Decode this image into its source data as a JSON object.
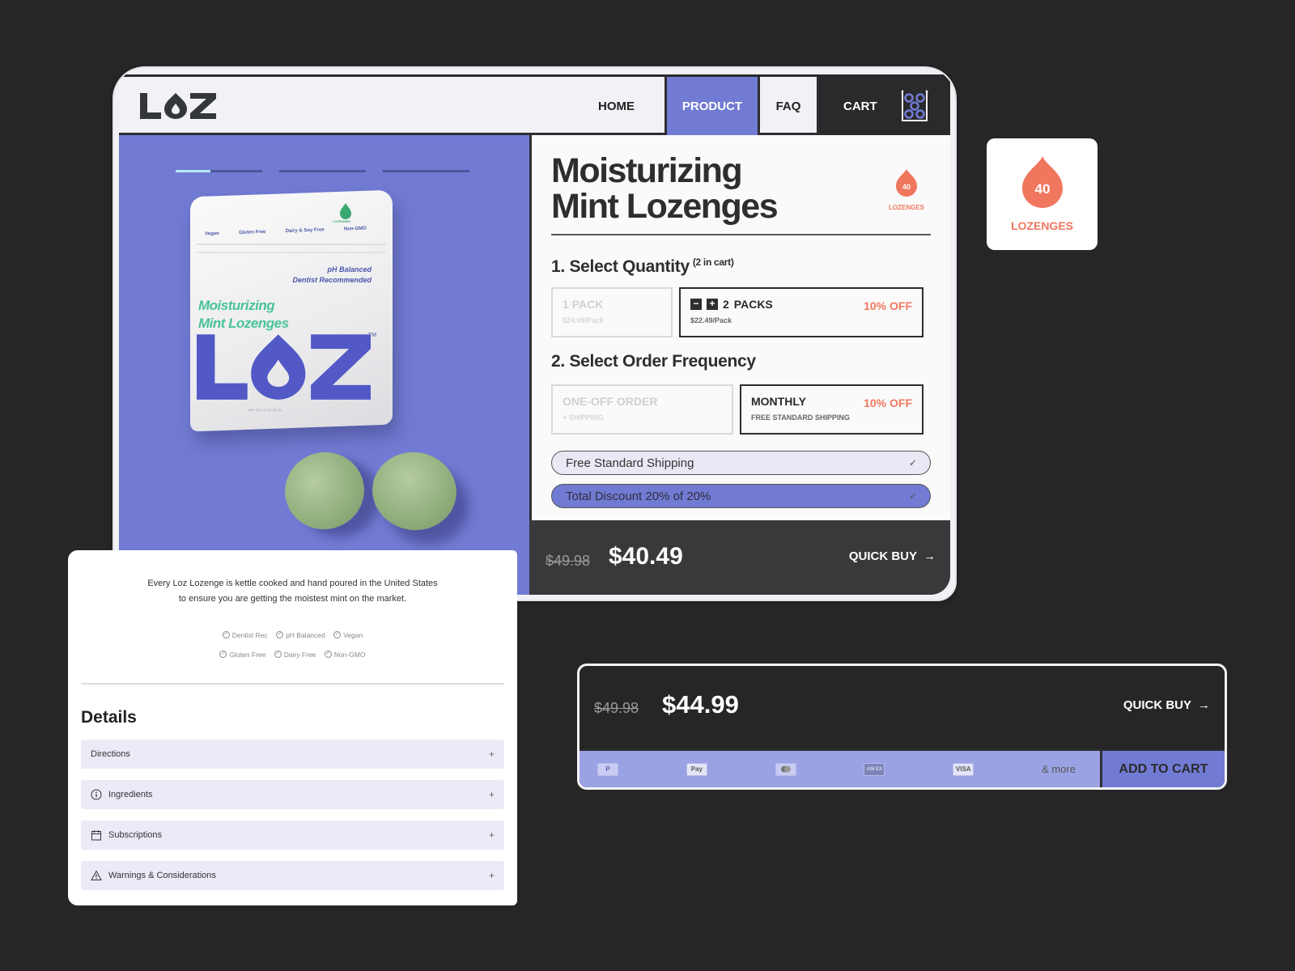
{
  "nav": {
    "logo": "LOZ",
    "links": [
      "HOME",
      "PRODUCT",
      "FAQ",
      "CART"
    ],
    "active": "PRODUCT"
  },
  "hero": {
    "slides_count": 3,
    "active_slide": 1,
    "active_slide_progress": 0.4,
    "pouch": {
      "tags": [
        "Vegan",
        "Gluten Free",
        "Dairy & Soy Free",
        "Non-GMO"
      ],
      "claims": [
        "pH Balanced",
        "Dentist Recommended"
      ],
      "name_line1": "Moisturizing",
      "name_line2": "Mint Lozenges",
      "logo": "LOZ",
      "tm": "TM",
      "net_wt": "NET WT 3.1 OZ (90 G)",
      "drop_label": "LOZENGES"
    }
  },
  "product": {
    "title_line1": "Moisturizing",
    "title_line2": "Mint Lozenges",
    "count": "40",
    "count_label": "LOZENGES"
  },
  "quantity": {
    "title": "1. Select Quantity",
    "cart_note": "(2 in cart)",
    "options": [
      {
        "label": "1 PACK",
        "sub": "$24.99/Pack",
        "selected": false
      },
      {
        "qty": "2",
        "label": "PACKS",
        "sub": "$22.49/Pack",
        "discount": "10% OFF",
        "selected": true
      }
    ],
    "minus": "−",
    "plus": "+"
  },
  "frequency": {
    "title": "2. Select Order Frequency",
    "options": [
      {
        "label": "ONE-OFF ORDER",
        "sub": "+ SHIPPING",
        "selected": false
      },
      {
        "label": "MONTHLY",
        "sub": "FREE STANDARD SHIPPING",
        "discount": "10% OFF",
        "selected": true
      }
    ]
  },
  "summary": {
    "shipping": "Free Standard Shipping",
    "discount": "Total Discount 20% of 20%",
    "check": "✓"
  },
  "buybar": {
    "original_price": "$49.98",
    "price": "$40.49",
    "quick_buy": "QUICK BUY",
    "arrow": "→"
  },
  "badge": {
    "count": "40",
    "label": "LOZENGES"
  },
  "details": {
    "description": "Every Loz Lozenge is kettle cooked and hand poured in the United States to ensure you are getting the moistest mint on the market.",
    "features_row1": [
      "Dentist Rec",
      "pH Balanced",
      "Vegan"
    ],
    "features_row2": [
      "Gluten Free",
      "Dairy Free",
      "Non-GMO"
    ],
    "title": "Details",
    "accordions": [
      {
        "label": "Directions",
        "icon": "none"
      },
      {
        "label": "Ingredients",
        "icon": "info-icon"
      },
      {
        "label": "Subscriptions",
        "icon": "calendar-icon"
      },
      {
        "label": "Warnings & Considerations",
        "icon": "warning-icon"
      }
    ],
    "plus": "+"
  },
  "quickbuy_card": {
    "original_price": "$49.98",
    "price": "$44.99",
    "quick_buy": "QUICK BUY",
    "arrow": "→",
    "payments": [
      "P",
      "Pay",
      "",
      "AM EX",
      "VISA"
    ],
    "more": "& more",
    "add_to_cart": "ADD TO CART"
  },
  "colors": {
    "brand_purple": "#717bd3",
    "accent_coral": "#f0775e",
    "dark": "#2e2e30",
    "mint": "#48c396"
  }
}
